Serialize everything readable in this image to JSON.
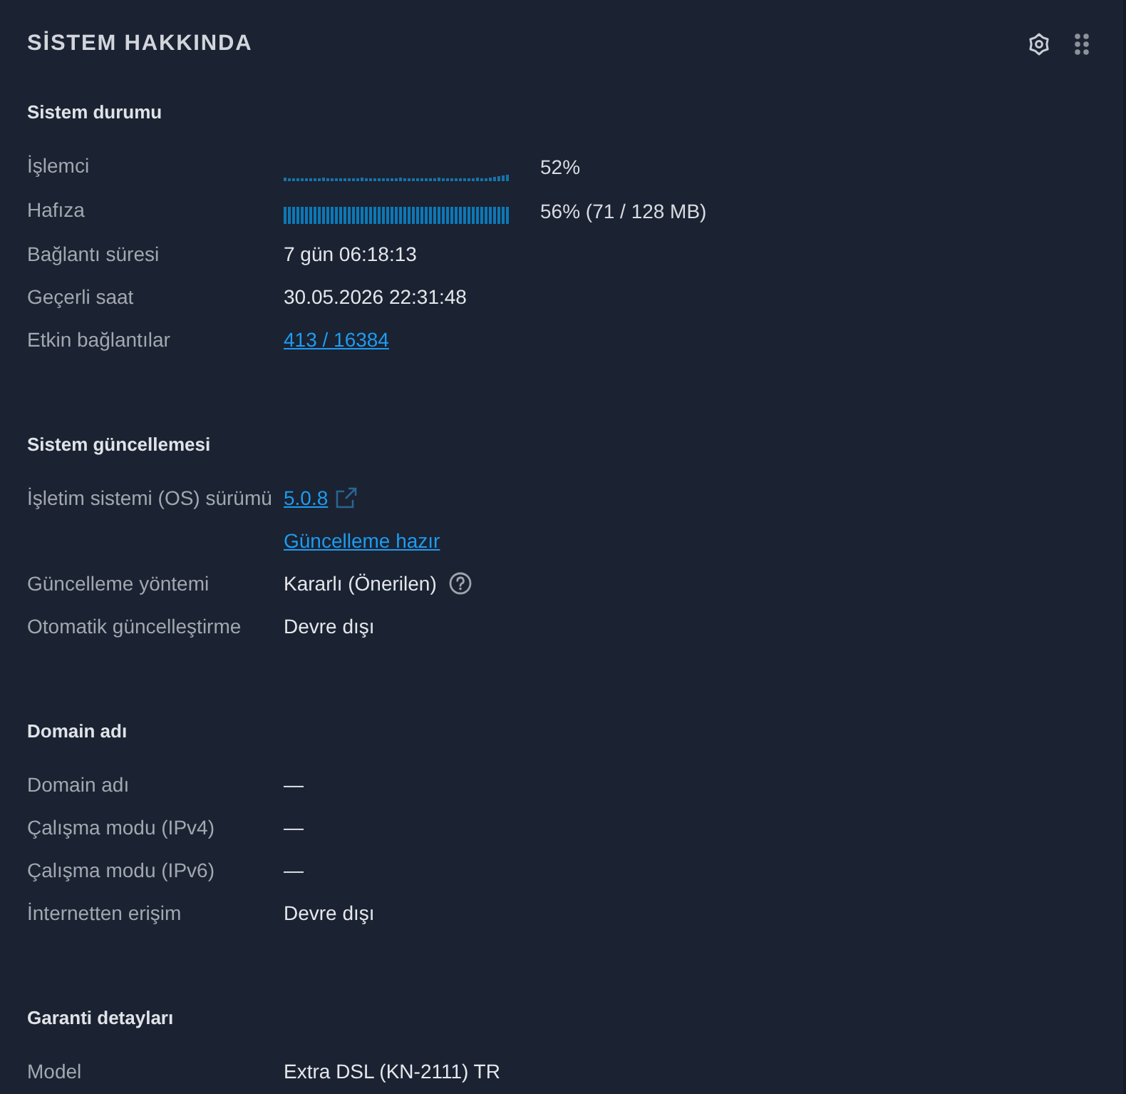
{
  "panel": {
    "title": "SİSTEM HAKKINDA"
  },
  "sections": [
    {
      "title": "Sistem durumu",
      "rows": [
        {
          "label": "İşlemci",
          "kind": "lowgraph",
          "value": "52%"
        },
        {
          "label": "Hafıza",
          "kind": "fullgraph",
          "value": "56% (71 / 128 MB)"
        },
        {
          "label": "Bağlantı süresi",
          "kind": "text",
          "value": "7 gün 06:18:13"
        },
        {
          "label": "Geçerli saat",
          "kind": "text",
          "value": "30.05.2026 22:31:48"
        },
        {
          "label": "Etkin bağlantılar",
          "kind": "link",
          "value": "413 / 16384"
        }
      ]
    },
    {
      "title": "Sistem güncellemesi",
      "rows": [
        {
          "label": "İşletim sistemi (OS) sürümü",
          "kind": "extlink",
          "value": "5.0.8"
        },
        {
          "kind": "link",
          "value": "Güncelleme hazır"
        },
        {
          "label": "Güncelleme yöntemi",
          "kind": "helptext",
          "value": "Kararlı (Önerilen)"
        },
        {
          "label": "Otomatik güncelleştirme",
          "kind": "text",
          "value": "Devre dışı"
        }
      ]
    },
    {
      "title": "Domain adı",
      "rows": [
        {
          "label": "Domain adı",
          "kind": "text",
          "value": "—"
        },
        {
          "label": "Çalışma modu (IPv4)",
          "kind": "text",
          "value": "—"
        },
        {
          "label": "Çalışma modu (IPv6)",
          "kind": "text",
          "value": "—"
        },
        {
          "label": "İnternetten erişim",
          "kind": "text",
          "value": "Devre dışı"
        }
      ]
    },
    {
      "title": "Garanti detayları",
      "rows": [
        {
          "label": "Model",
          "kind": "text",
          "value": "Extra DSL (KN-2111) TR"
        }
      ]
    }
  ]
}
